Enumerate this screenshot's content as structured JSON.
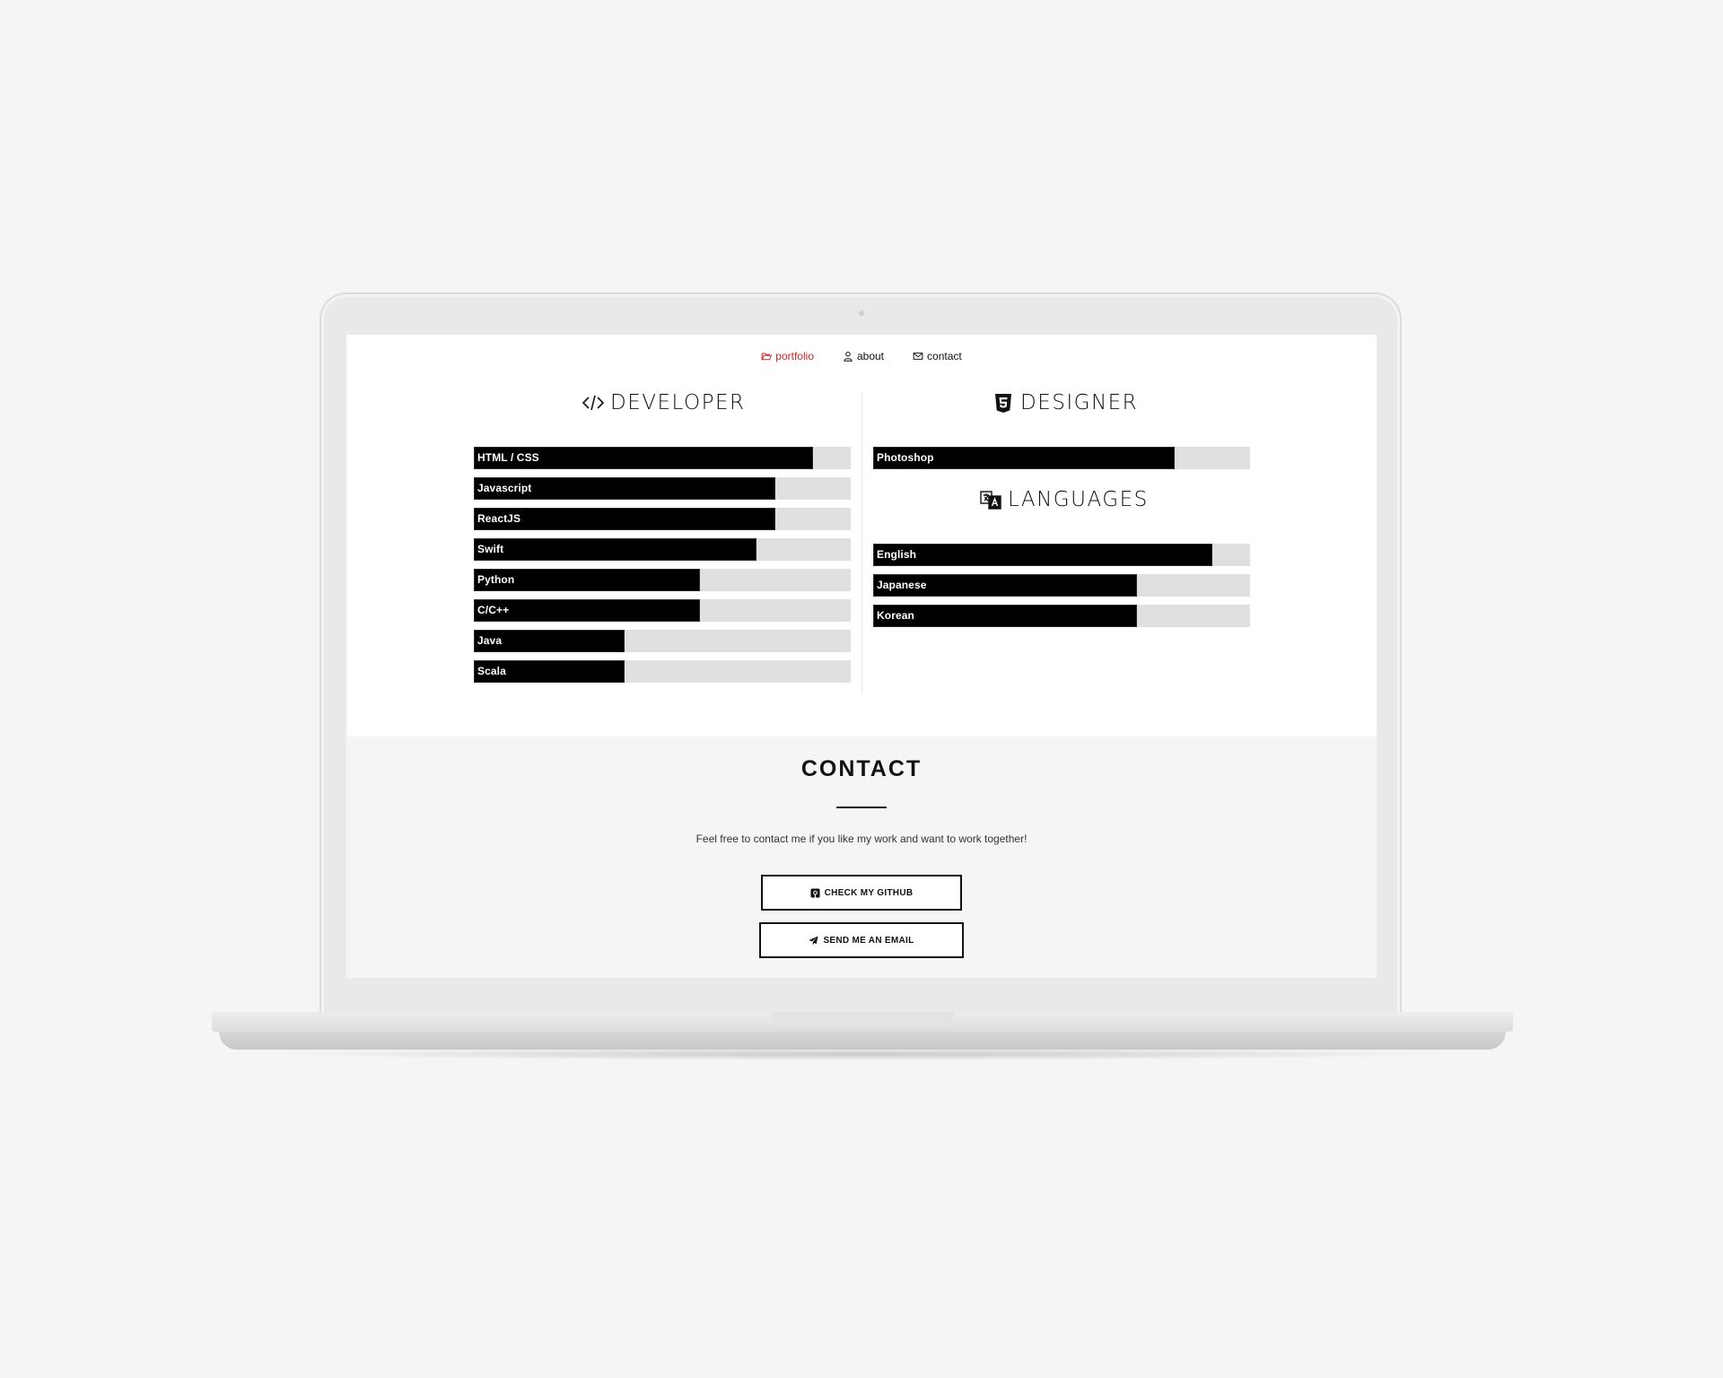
{
  "nav": {
    "items": [
      {
        "label": "portfolio",
        "icon": "folder-icon",
        "active": true
      },
      {
        "label": "about",
        "icon": "user-icon",
        "active": false
      },
      {
        "label": "contact",
        "icon": "envelope-icon",
        "active": false
      }
    ],
    "active_color": "#c62828"
  },
  "developer": {
    "title": "DEVELOPER",
    "icon": "code-icon",
    "skills": [
      {
        "label": "HTML / CSS",
        "percent": 90
      },
      {
        "label": "Javascript",
        "percent": 80
      },
      {
        "label": "ReactJS",
        "percent": 80
      },
      {
        "label": "Swift",
        "percent": 75
      },
      {
        "label": "Python",
        "percent": 60
      },
      {
        "label": "C/C++",
        "percent": 60
      },
      {
        "label": "Java",
        "percent": 40
      },
      {
        "label": "Scala",
        "percent": 40
      }
    ]
  },
  "designer": {
    "title": "DESIGNER",
    "icon": "html5-icon",
    "skills": [
      {
        "label": "Photoshop",
        "percent": 80
      }
    ]
  },
  "languages": {
    "title": "LANGUAGES",
    "icon": "language-icon",
    "skills": [
      {
        "label": "English",
        "percent": 90
      },
      {
        "label": "Japanese",
        "percent": 70
      },
      {
        "label": "Korean",
        "percent": 70
      }
    ]
  },
  "contact": {
    "title": "CONTACT",
    "text": "Feel free to contact me if you like my work and want to work together!",
    "github_label": "CHECK MY GITHUB",
    "github_icon": "github-icon",
    "email_label": "SEND ME AN EMAIL",
    "email_icon": "paper-plane-icon"
  }
}
